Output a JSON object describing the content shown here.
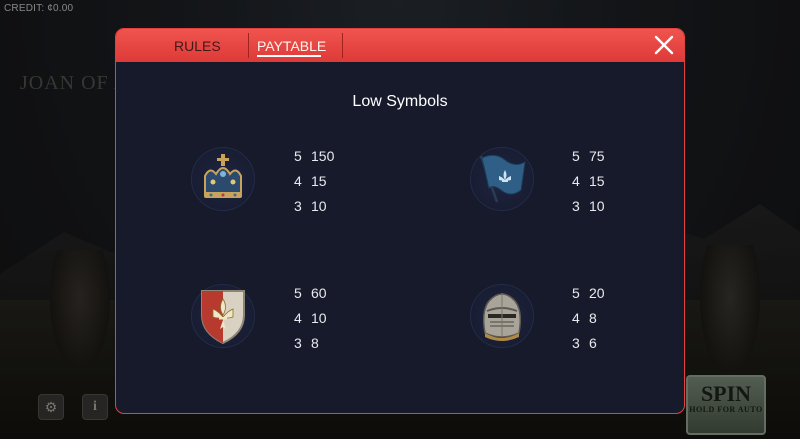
{
  "background": {
    "credit": "CREDIT: ¢0.00",
    "game_title": "JOAN OF A...",
    "spin_label": "SPIN",
    "spin_sub": "HOLD FOR AUTO"
  },
  "modal": {
    "tabs": [
      {
        "label": "RULES",
        "active": false
      },
      {
        "label": "PAYTABLE",
        "active": true
      }
    ],
    "close_icon": "close-icon",
    "section_title": "Low Symbols",
    "symbols": [
      {
        "icon": "crown-icon",
        "pays": [
          {
            "count": "5",
            "value": "150"
          },
          {
            "count": "4",
            "value": "15"
          },
          {
            "count": "3",
            "value": "10"
          }
        ]
      },
      {
        "icon": "flag-icon",
        "pays": [
          {
            "count": "5",
            "value": "75"
          },
          {
            "count": "4",
            "value": "15"
          },
          {
            "count": "3",
            "value": "10"
          }
        ]
      },
      {
        "icon": "shield-icon",
        "pays": [
          {
            "count": "5",
            "value": "60"
          },
          {
            "count": "4",
            "value": "10"
          },
          {
            "count": "3",
            "value": "8"
          }
        ]
      },
      {
        "icon": "helmet-icon",
        "pays": [
          {
            "count": "5",
            "value": "20"
          },
          {
            "count": "4",
            "value": "8"
          },
          {
            "count": "3",
            "value": "6"
          }
        ]
      }
    ]
  },
  "colors": {
    "header_red": "#e2413e",
    "panel_bg": "#161a2b"
  }
}
